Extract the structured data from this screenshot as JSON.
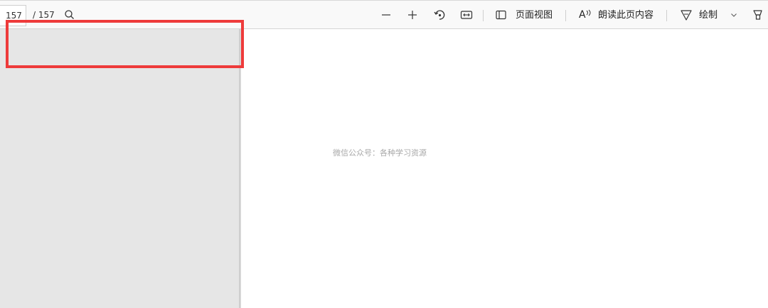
{
  "toolbar": {
    "page_current": "157",
    "page_total": "/ 157",
    "icons": {
      "search": "search-icon",
      "zoom_out": "minus-icon",
      "zoom_in": "plus-icon",
      "rotate": "rotate-icon",
      "fit_width": "fit-width-icon",
      "page_view": "page-view-icon",
      "read_aloud": "read-aloud-icon",
      "draw": "draw-icon",
      "dropdown": "chevron-down-icon",
      "highlight": "highlighter-icon"
    },
    "page_view_label": "页面视图",
    "read_aloud_label": "朗读此页内容",
    "read_aloud_glyph": "A",
    "draw_label": "绘制"
  },
  "document": {
    "watermark": "微信公众号：各种学习资源"
  },
  "colors": {
    "highlight_box": "#ee3b3b",
    "sidebar": "#e6e6e6",
    "toolbar": "#f9f9f9"
  }
}
